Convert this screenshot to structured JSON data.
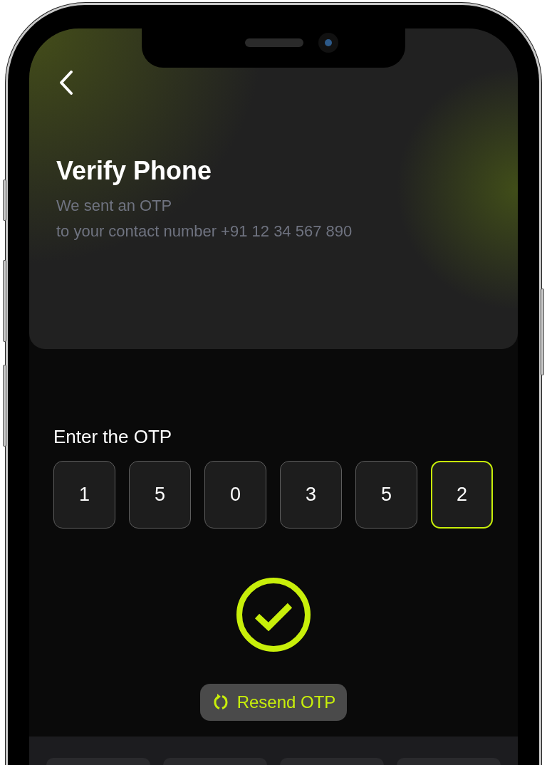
{
  "header": {
    "title": "Verify Phone",
    "subtitle_lines": [
      "We sent an OTP",
      "to your contact number +91 12 34 567 890"
    ]
  },
  "otp": {
    "label": "Enter the OTP",
    "digits": [
      {
        "value": "1",
        "selected": false
      },
      {
        "value": "5",
        "selected": false
      },
      {
        "value": "0",
        "selected": false
      },
      {
        "value": "3",
        "selected": false
      },
      {
        "value": "5",
        "selected": false
      },
      {
        "value": "2",
        "selected": true
      }
    ],
    "verified": true
  },
  "resend_button": {
    "label": "Resend OTP"
  }
}
